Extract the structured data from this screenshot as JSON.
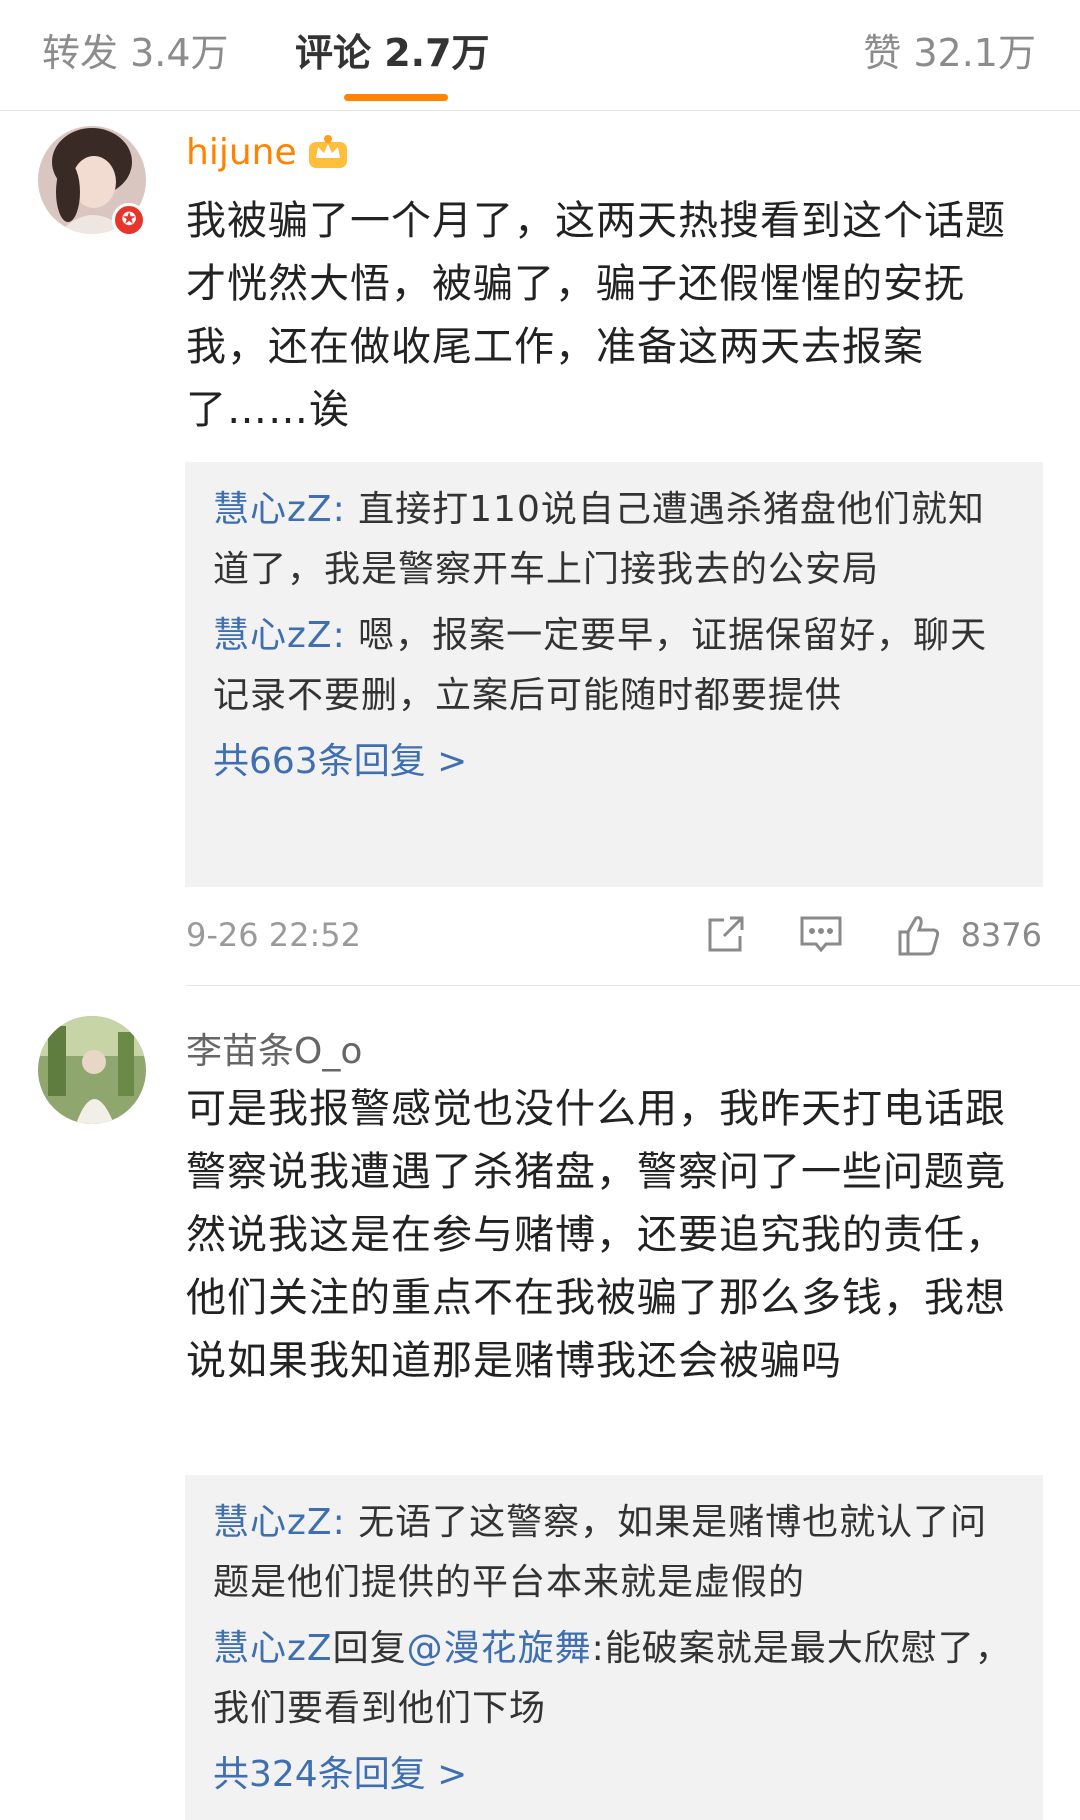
{
  "tabs": {
    "forward": "转发 3.4万",
    "comments": "评论 2.7万",
    "likes": "赞 32.1万"
  },
  "comments": [
    {
      "username": "hijune",
      "text": "我被骗了一个月了，这两天热搜看到这个话题才恍然大悟，被骗了，骗子还假惺惺的安抚我，还在做收尾工作，准备这两天去报案了……诶",
      "replies": [
        {
          "name": "慧心zZ",
          "sep": ": ",
          "text": "直接打110说自己遭遇杀猪盘他们就知道了，我是警察开车上门接我去的公安局"
        },
        {
          "name": "慧心zZ",
          "sep": ": ",
          "text": "嗯，报案一定要早，证据保留好，聊天记录不要删，立案后可能随时都要提供"
        }
      ],
      "reply_count": "共663条回复 >",
      "time": "9-26 22:52",
      "likes": "8376"
    },
    {
      "username": "李苗条O_o",
      "text": "可是我报警感觉也没什么用，我昨天打电话跟警察说我遭遇了杀猪盘，警察问了一些问题竟然说我这是在参与赌博，还要追究我的责任，他们关注的重点不在我被骗了那么多钱，我想说如果我知道那是赌博我还会被骗吗",
      "replies": [
        {
          "name": "慧心zZ",
          "sep": ": ",
          "text": "无语了这警察，如果是赌博也就认了问题是他们提供的平台本来就是虚假的"
        },
        {
          "name": "慧心zZ",
          "reply_word": "回复",
          "mention": "@漫花旋舞",
          "text": ":能破案就是最大欣慰了，我们要看到他们下场"
        }
      ],
      "reply_count": "共324条回复 >"
    }
  ],
  "colors": {
    "accent": "#ff8200",
    "link": "#3f6fb0",
    "badge": "#e8352c"
  }
}
